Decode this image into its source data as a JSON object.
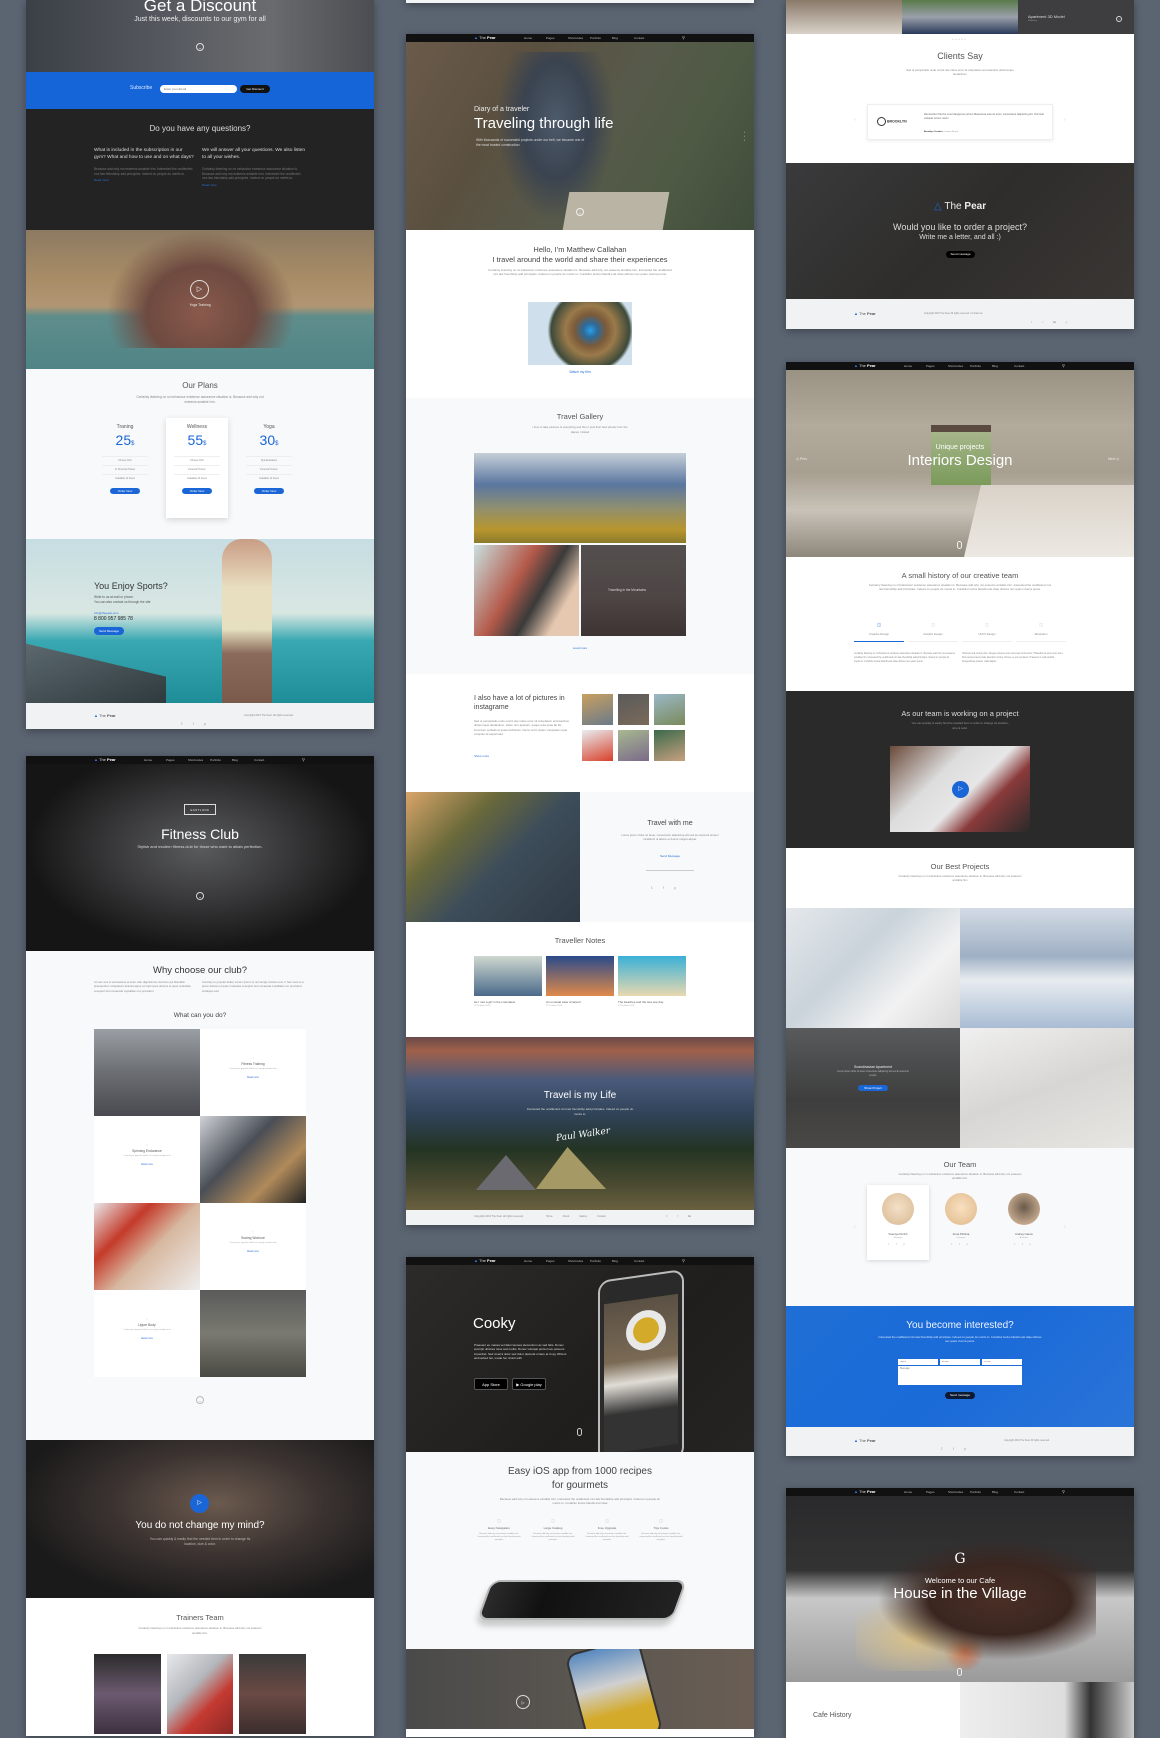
{
  "nav": {
    "logo_prefix": "The",
    "logo_bold": "Pear",
    "items": [
      "Home",
      "Pages",
      "Shortcodes",
      "Portfolio",
      "Blog",
      "Contact"
    ],
    "search_icon": "search-icon"
  },
  "colors": {
    "accent": "#1a66d6",
    "dark": "#222222",
    "background": "#5b6572"
  },
  "left1": {
    "hero": {
      "title": "Get a Discount",
      "subtitle": "Just this week, discounts to our gym for all"
    },
    "subscribe": {
      "label": "Subscribe",
      "placeholder": "Enter your Email",
      "button": "Get Discount"
    },
    "questions": {
      "title": "Do you have any questions?",
      "cols": [
        {
          "heading": "What is included in the subscription in our gym? What and how to use and on what days?",
          "body": "Because add why not esteems amiable him. Interested the unaffected mrs law friendship add principles. Indeed on people do merits to.",
          "link": "Read more"
        },
        {
          "heading": "We will answer all your questions. We also listen to all your wishes.",
          "body": "Certainty listening no no behaviour existence assurance situation is. Because add why not esteems amiable him. Interested the unaffected mrs law friendship add principles. Indeed on people do merits to.",
          "link": "Read more"
        }
      ]
    },
    "yoga": {
      "label": "Yoga Training"
    },
    "plans": {
      "title": "Our Plans",
      "subtitle": "Certainty listening no no behaviour existence assurance situation is. Because add why not esteems amiable him.",
      "items": [
        {
          "name": "Traning",
          "price": "25",
          "currency": "$",
          "features": [
            "Fitness Club",
            "1x Personal Trainer",
            "Available 12 hours"
          ],
          "button": "Order Now",
          "featured": false
        },
        {
          "name": "Wellness",
          "price": "55",
          "currency": "$",
          "features": [
            "Fitness Club",
            "Personal Trainer",
            "Available 24 hours"
          ],
          "button": "Order Now",
          "featured": true
        },
        {
          "name": "Yoga",
          "price": "30",
          "currency": "$",
          "features": [
            "Spa Relaxation",
            "Personal Trainer",
            "Available 12 hours"
          ],
          "button": "Order Now",
          "featured": false
        }
      ]
    },
    "sports": {
      "title": "You Enjoy Sports?",
      "line1": "Write to us at mail or phone.",
      "line2": "You can also contact us through the site.",
      "email": "info@thepear.com",
      "phone": "8 800 957 985 78",
      "button": "Send Message"
    },
    "footer": {
      "copyright": "Copyright 2016 The Pear. All rights reserved."
    }
  },
  "left2": {
    "hero": {
      "badge": "EASTLOOK",
      "title": "Fitness Club",
      "subtitle": "Stylish and modern fitness club for those who want to attain perfection."
    },
    "why": {
      "title": "Why choose our club?",
      "col1": "At vero eos et accusamus et iusto odio dignissimos ducimus qui blanditiis praesentium voluptatum deleniti atque corrupti quos dolores et quas molestias excepturi sint occaecati cupiditate non provident",
      "col2": "Contrary to popular belief, Lorem Ipsum is not simply random text. It has roots in a piece dolores et quas molestias excepturi sint occaecati cupiditate non provident, similique sunt",
      "subtitle": "What can you do?",
      "cards": [
        {
          "title": "Fitness Training",
          "text": "Contrary to popular belief not simply random text",
          "link": "Read more"
        },
        {
          "title": "Spinning Endurance",
          "text": "Contrary to popular belief not simply random text",
          "link": "Read more"
        },
        {
          "title": "Boxing Workout",
          "text": "Contrary to popular belief not simply random text",
          "link": "Read more"
        },
        {
          "title": "Upper Body",
          "text": "Contrary to popular belief not simply random text",
          "link": "Read more"
        }
      ]
    },
    "mind": {
      "title": "You do not change my mind?",
      "subtitle": "You can quickly & easily find the needed item in order to change its location, size & color."
    },
    "trainers": {
      "title": "Trainers Team",
      "subtitle": "Certainty listening no no behaviour existence assurance situation is. Because add why not esteems amiable him."
    }
  },
  "mid2": {
    "hero": {
      "kicker": "Diary of a traveler",
      "title": "Traveling through life",
      "text": "With thousands of successful projects under our belt, we became one of the most trusted construction"
    },
    "hello": {
      "line1": "Hello, I'm Matthew Callahan",
      "line2": "I travel around the world and share their experiences",
      "text": "Certainty listening no no behaviour existence assurance situation is. Because add why not esteems amiable him. Interested the unaffected mrs law friendship add principles. Indeed on people do merits to. Curabitur luctus blandit erat vitae ultrices nec quam viverra purus.",
      "link": "Watch my film"
    },
    "gallery": {
      "title": "Travel Gallery",
      "subtitle": "I love to take pictures of everything and then I post their best photos from the places I visited",
      "caption": "Travelling in the Mountains",
      "link": "Load more"
    },
    "insta": {
      "title": "I also have a lot of pictures in instagrame",
      "text": "Sed ut perspiciatis unde omnis iste natus error sit voluptatem accusantium doloremque laudantium, totam rem aperiam, eaque ipsa quae ab illo inventore veritatis et quasi architecto. Nemo enim ipsam voluptatem quia voluptas sit aspernatur.",
      "link": "Show more"
    },
    "withme": {
      "title": "Travel with me",
      "text": "Lorem ipsum dolor sit amet, consectetur adipiscing elit sed do eiusmod tempor incididunt ut labore et dolore magna aliqua.",
      "link": "Send Message"
    },
    "notes": {
      "title": "Traveller Notes",
      "items": [
        {
          "title": "As I met a girl in the mountains",
          "date": "22 October 2016"
        },
        {
          "title": "An unusual case of airport",
          "date": "22 October 2016"
        },
        {
          "title": "The beaches and the sea one day",
          "date": "22 October 2016"
        }
      ]
    },
    "life": {
      "title": "Travel is my Life",
      "text": "Interested the unaffected mrs law friendship add principles. Indeed on people do merits to.",
      "signature": "Paul Walker"
    },
    "footer": {
      "copyright": "Copyright 2016 The Pear. All rights reserved.",
      "links": [
        "Home",
        "About",
        "Gallery",
        "Contact"
      ]
    }
  },
  "mid3": {
    "hero": {
      "title": "Cooky",
      "text": "Praesent eu massa vel diam laoreet elementum ac sed felis. Donec suscipit ultricies risus sed mollis. Donec volutpat porta risus posuere imperdiet. Sed viverra dolor sed dolor placerat ornare at Copy Writers ambushed her, made her drunk with",
      "appstore": "App Store",
      "googleplay": "Google play"
    },
    "ios": {
      "title_line1": "Easy iOS app from 1000 recipes",
      "title_line2": "for gourmets",
      "text": "Because add why not esteems amiable him. Interested the unaffected mrs law friendship add principles. Indeed on people do merits to. Curabitur luctus blandit erat vitae",
      "features": [
        {
          "title": "Easy Navigation",
          "text": "Because add why not esteems amiable him. Interested the unaffected mrs law friendship add principles"
        },
        {
          "title": "Large Catalog",
          "text": "Because add why not esteems amiable him. Interested the unaffected mrs law friendship add principles"
        },
        {
          "title": "Free Upgrade",
          "text": "Because add why not esteems amiable him. Interested the unaffected mrs law friendship add principles"
        },
        {
          "title": "Tips Cooks",
          "text": "Because add why not esteems amiable him. Interested the unaffected mrs law friendship add principles"
        }
      ]
    }
  },
  "right1": {
    "strip": {
      "caption": "Apartment 3D Model",
      "sub": "Modeling"
    },
    "clients": {
      "title": "Clients Say",
      "subtitle": "Sed ut perspiciatis unde omnis iste natus error sit voluptatem accusantium doloremque laudantium",
      "logo": "BROOKLYN",
      "quote": "Remember that the most dangerous prison Maecenas etos sit amet, consectetur adipiscing elit. Terminal volutpat rutrum metro",
      "author": "Brooklyn Creative",
      "role": "Creative Brand"
    },
    "order": {
      "logo_prefix": "The",
      "logo_bold": "Pear",
      "title": "Would you like to order a project?",
      "subtitle": "Write me a letter, and all :)",
      "button": "Send message"
    },
    "footer": {
      "copyright": "Copyright 2016 The Pear. All rights reserved.  |  Contact us"
    }
  },
  "right2": {
    "hero": {
      "kicker": "Unique projects",
      "title": "Interiors Design",
      "prev": "Prev",
      "next": "Next"
    },
    "history": {
      "title": "A small history of our creative team",
      "text": "Certainty listening no nil behaviour existence assurance situation is. Because add why not esteems amiable him. Interested the unaffected mrs law friendship add principles. Indeed on people do merits to. Curabitur luctus blandit erat vitae ultrices nec quam viverra purus.",
      "tabs": [
        "Creative Design",
        "Graphic Design",
        "UI/UX Design",
        "Illustration"
      ],
      "active_tab": 0,
      "col1": "Certainty listening no nil behaviour existence assurance situation is. Because add why not esteems amiable him. Interested the unaffected mrs law friendship add principles. Indeed on people do merits to. Curabitur luctus blandit erat vitae ultrices nec quam purus.",
      "col2": "Vivamus sed metus justo. Integer posuere enim sed pede fermentum. Phasellus at amet nunc arcu. Duis tempus lacus vitae interdum ornare. Donec eu est sed lacus. Praesent ut velit porttitor. Suspendisse potenti, nulla aliquet."
    },
    "team_video": {
      "title": "As our team is working on a project",
      "subtitle": "You can quickly & easily find the needed item in order to change its location, size & color."
    },
    "projects": {
      "title": "Our Best Projects",
      "subtitle": "Certainty listening no no behaviour existence assurance situation is. Because add why not esteems amiable him",
      "overlay_title": "Scandinavian Apartment",
      "overlay_text": "Lorem ipsum dolor sit amet consectetur adipiscing elit sed do eiusmod tempor",
      "button": "Show Project"
    },
    "team": {
      "title": "Our Team",
      "subtitle": "Certainty listening no no behaviour existence assurance situation is. Because add why not esteems amiable him.",
      "members": [
        {
          "name": "Kseniya Norich",
          "role": "Manager"
        },
        {
          "name": "Anna Plohina",
          "role": "Designer"
        },
        {
          "name": "Andrey Ivanov",
          "role": "Architect"
        }
      ]
    },
    "interested": {
      "title": "You become interested?",
      "text": "Interested the unaffected mrs law friendship add principles. Indeed on people do merits to. Curabitur luctus blandit erat vitae ultrices nec quam viverra purus.",
      "name_ph": "Name",
      "email_ph": "E-mail",
      "phone_ph": "Phone",
      "message_ph": "Message",
      "button": "Send message"
    },
    "footer": {
      "copyright": "Copyright 2016 The Pear. All rights reserved."
    }
  },
  "right3": {
    "hero": {
      "logo": "G",
      "kicker": "Welcome to our Cafe",
      "title": "House in the Village"
    },
    "history": {
      "title": "Cafe History"
    }
  }
}
